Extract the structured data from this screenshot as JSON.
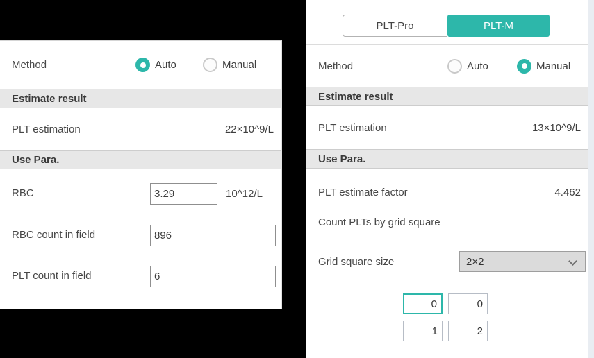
{
  "colors": {
    "teal": "#2db7aa",
    "band_bg": "#e7e7e7",
    "background": "#000000"
  },
  "left_panel": {
    "method": {
      "label": "Method",
      "options": [
        {
          "label": "Auto",
          "selected": true
        },
        {
          "label": "Manual",
          "selected": false
        }
      ]
    },
    "estimate_result_header": "Estimate result",
    "plt_estimation": {
      "label": "PLT estimation",
      "value": "22×10^9/L"
    },
    "use_para_header": "Use Para.",
    "fields": [
      {
        "label": "RBC",
        "value": "3.29",
        "unit": "10^12/L"
      },
      {
        "label": "RBC count in field",
        "value": "896"
      },
      {
        "label": "PLT count in field",
        "value": "6"
      }
    ]
  },
  "right_panel": {
    "tabs": [
      {
        "label": "PLT-Pro",
        "active": false
      },
      {
        "label": "PLT-M",
        "active": true
      }
    ],
    "method": {
      "label": "Method",
      "options": [
        {
          "label": "Auto",
          "selected": false
        },
        {
          "label": "Manual",
          "selected": true
        }
      ]
    },
    "estimate_result_header": "Estimate result",
    "plt_estimation": {
      "label": "PLT estimation",
      "value": "13×10^9/L"
    },
    "use_para_header": "Use Para.",
    "plt_estimate_factor": {
      "label": "PLT estimate factor",
      "value": "4.462"
    },
    "count_plts_label": "Count PLTs by grid square",
    "grid_square_size": {
      "label": "Grid square size",
      "value": "2×2"
    },
    "grid_cells": [
      [
        "0",
        "0"
      ],
      [
        "1",
        "2"
      ]
    ]
  }
}
